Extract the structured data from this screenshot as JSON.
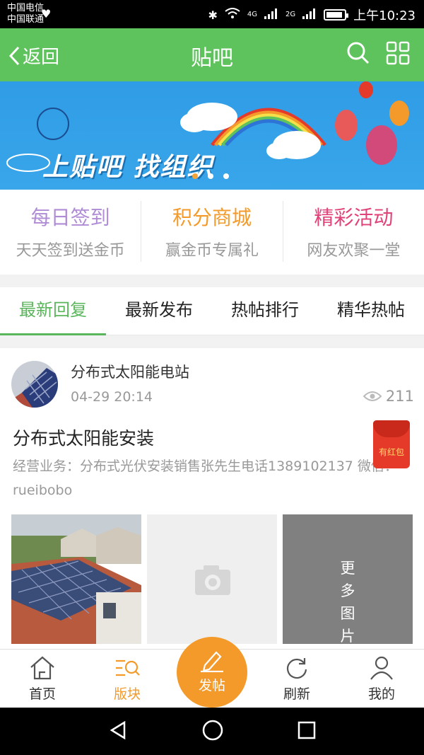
{
  "status_bar": {
    "carrier1": "中国电信",
    "carrier2": "中国联通",
    "net1": "4G",
    "net2": "2G",
    "time": "上午10:23",
    "battery_level": 0.9
  },
  "navbar": {
    "back_label": "返回",
    "title": "贴吧"
  },
  "banner": {
    "slogan": "上贴吧 找组织",
    "slide_count": 3,
    "active_slide": 1
  },
  "quick_links": [
    {
      "title": "每日签到",
      "subtitle": "天天签到送金币",
      "color": "#b08bd6"
    },
    {
      "title": "积分商城",
      "subtitle": "赢金币专属礼",
      "color": "#f39a2b"
    },
    {
      "title": "精彩活动",
      "subtitle": "网友欢聚一堂",
      "color": "#e0427a"
    }
  ],
  "tabs": [
    {
      "label": "最新回复",
      "active": true
    },
    {
      "label": "最新发布",
      "active": false
    },
    {
      "label": "热帖排行",
      "active": false
    },
    {
      "label": "精华热帖",
      "active": false
    }
  ],
  "post": {
    "author": "分布式太阳能电站",
    "time": "04-29 20:14",
    "views": "211",
    "title": "分布式太阳能安装",
    "body": "经营业务：分布式光伏安装销售张先生电话1389102137  微信：rueibobo",
    "redpacket_label": "有红包",
    "more_pics_label": "更多图片"
  },
  "bottom_nav": [
    {
      "label": "首页",
      "icon": "home-icon",
      "active": false
    },
    {
      "label": "版块",
      "icon": "forum-list-icon",
      "active": true
    },
    {
      "label": "发帖",
      "icon": "pencil-icon",
      "active": false
    },
    {
      "label": "刷新",
      "icon": "refresh-icon",
      "active": false
    },
    {
      "label": "我的",
      "icon": "user-icon",
      "active": false
    }
  ],
  "colors": {
    "accent_green": "#5ec35c",
    "tab_active": "#5ab65a",
    "orange": "#f39a2b"
  }
}
